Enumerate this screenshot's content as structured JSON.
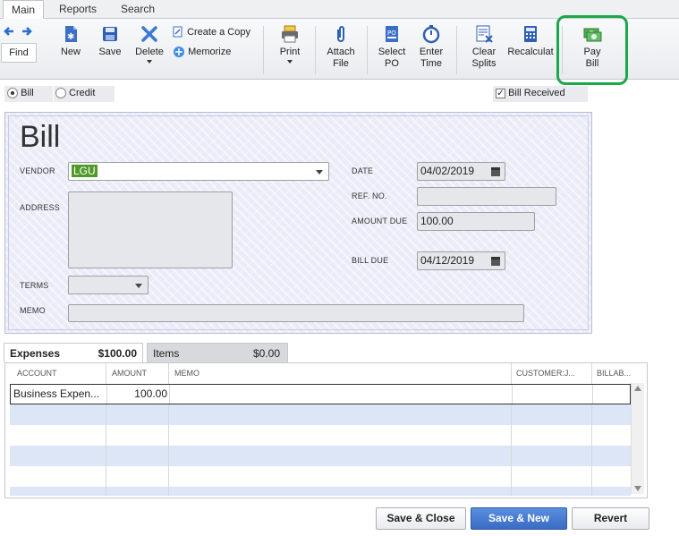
{
  "tabs": [
    "Main",
    "Reports",
    "Search"
  ],
  "toolbar": {
    "find": "Find",
    "new": "New",
    "save": "Save",
    "delete": "Delete",
    "create_copy": "Create a Copy",
    "memorize": "Memorize",
    "print": "Print",
    "attach_file_1": "Attach",
    "attach_file_2": "File",
    "select_po_1": "Select",
    "select_po_2": "PO",
    "enter_time_1": "Enter",
    "enter_time_2": "Time",
    "clear_splits_1": "Clear",
    "clear_splits_2": "Splits",
    "recalculate": "Recalculat",
    "pay_bill_1": "Pay",
    "pay_bill_2": "Bill"
  },
  "mode": {
    "bill": "Bill",
    "credit": "Credit",
    "bill_received": "Bill Received"
  },
  "form": {
    "title": "Bill",
    "vendor_label": "VENDOR",
    "vendor_value": "LGU",
    "address_label": "ADDRESS",
    "terms_label": "TERMS",
    "memo_label": "MEMO",
    "date_label": "DATE",
    "date_value": "04/02/2019",
    "ref_label": "REF. NO.",
    "amount_due_label": "AMOUNT DUE",
    "amount_due_value": "100.00",
    "bill_due_label": "BILL DUE",
    "bill_due_value": "04/12/2019"
  },
  "detail_tabs": {
    "expenses_label": "Expenses",
    "expenses_total": "$100.00",
    "items_label": "Items",
    "items_total": "$0.00"
  },
  "grid": {
    "headers": [
      "ACCOUNT",
      "AMOUNT",
      "MEMO",
      "CUSTOMER:J...",
      "BILLAB..."
    ],
    "rows": [
      {
        "account": "Business Expen...",
        "amount": "100.00"
      }
    ]
  },
  "buttons": {
    "save_close": "Save & Close",
    "save_new": "Save & New",
    "revert": "Revert"
  }
}
